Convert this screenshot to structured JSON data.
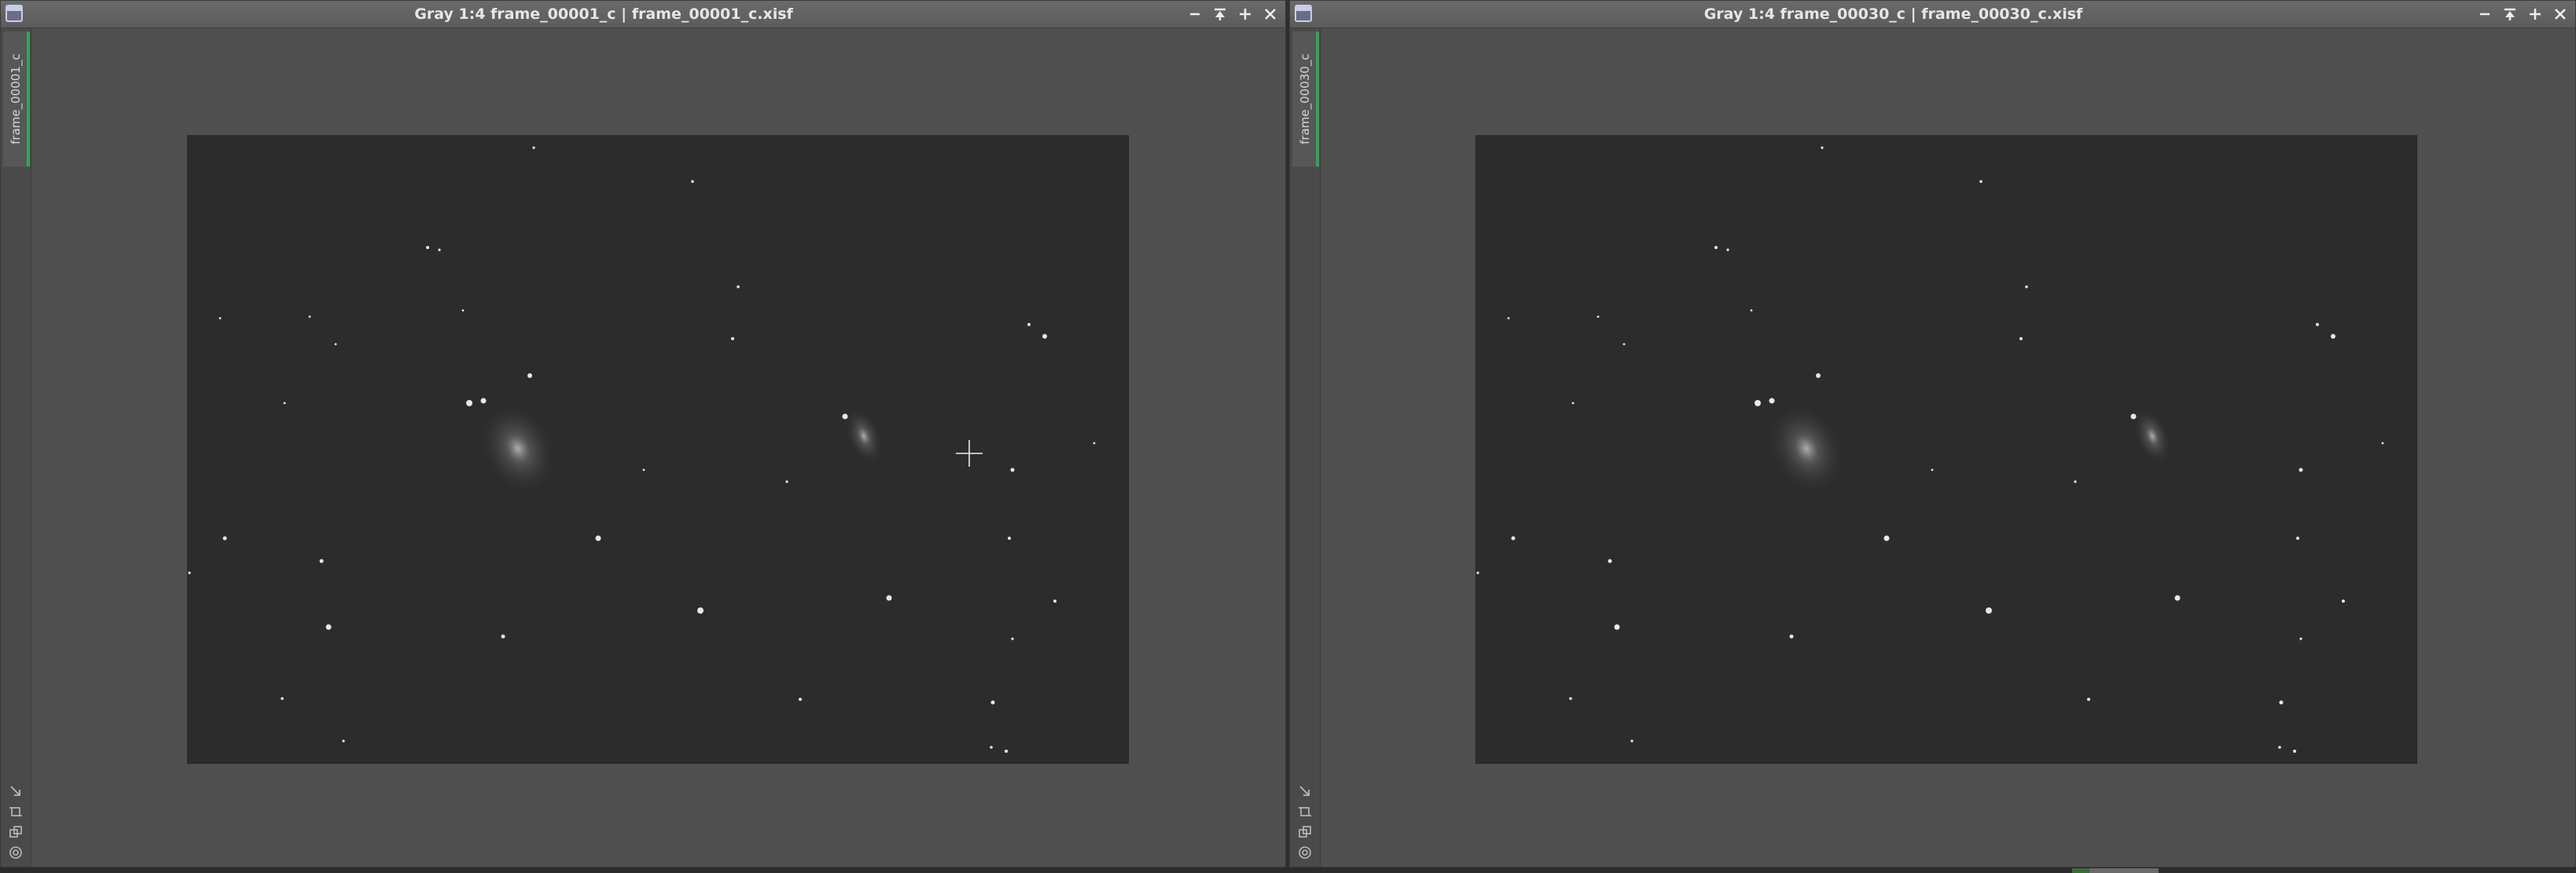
{
  "windows": [
    {
      "title": "Gray 1:4 frame_00001_c | frame_00001_c.xisf",
      "tab_label": "frame_00001_c",
      "icon": "window-icon"
    },
    {
      "title": "Gray 1:4 frame_00030_c | frame_00030_c.xisf",
      "tab_label": "frame_00030_c",
      "icon": "window-icon"
    }
  ],
  "controls": [
    "minimize-icon",
    "shade-icon",
    "maximize-icon",
    "close-icon"
  ],
  "tools": [
    "arrow-icon",
    "crop-icon",
    "copy-icon",
    "settings-icon"
  ],
  "colors": {
    "tab_accent": "#38a05a",
    "title_text": "#e6e6e6",
    "viewport_bg": "#4f4f4f",
    "image_bg": "#2c2c2c"
  }
}
